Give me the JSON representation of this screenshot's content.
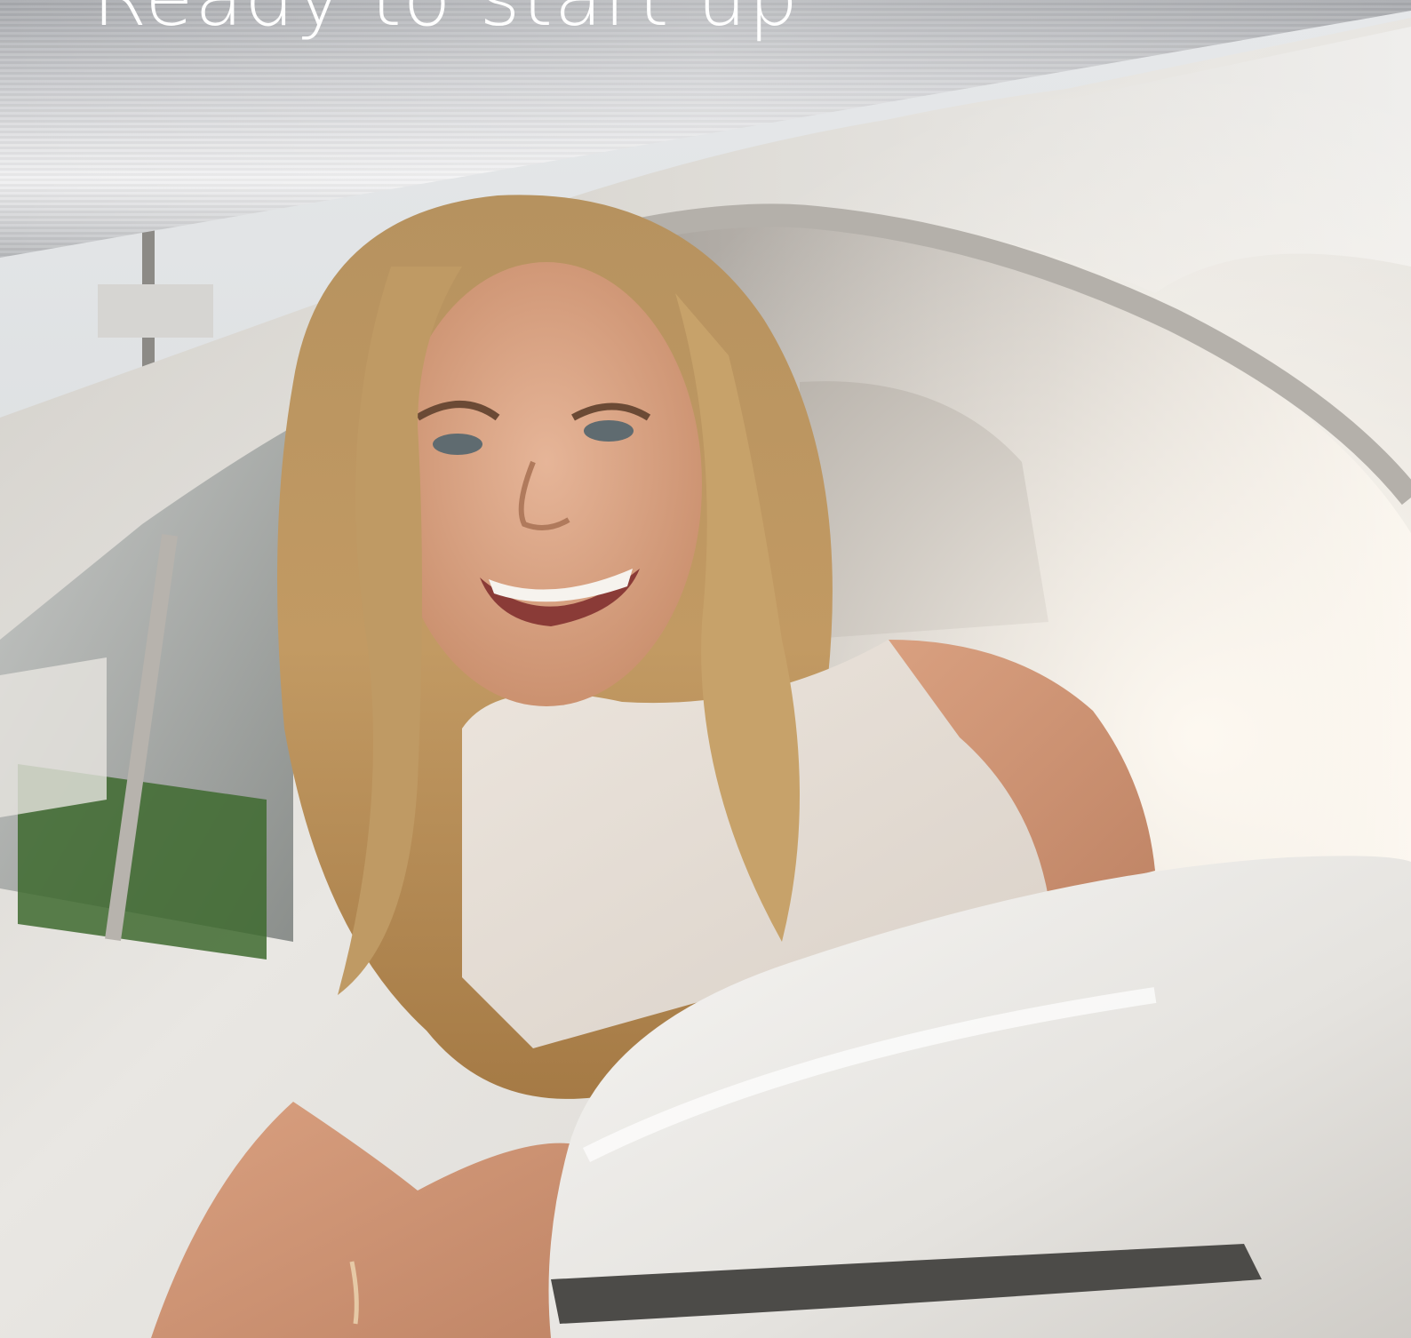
{
  "headline": "Ready to start up",
  "image": {
    "subject": "smiling woman with long blonde hair leaning out of a white car window",
    "colors": {
      "header_band_light": "#e9e9ea",
      "header_band_dark": "#8f9195",
      "car_white": "#f2f1ee",
      "hair_blonde": "#b58a52",
      "skin": "#d9a384",
      "top_cream": "#e8e0d8",
      "foliage": "#3f6a2e",
      "sky": "#dfe3e7"
    }
  }
}
